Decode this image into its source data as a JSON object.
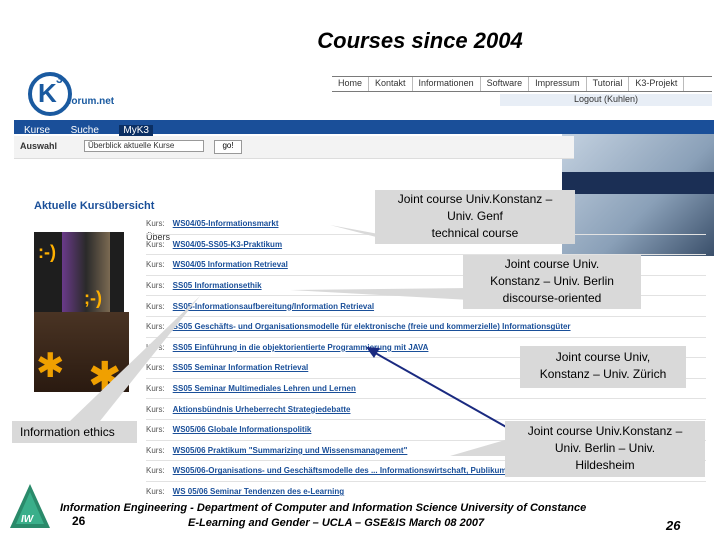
{
  "slide": {
    "title": "Courses since 2004",
    "footer_line1": "Information Engineering - Department of Computer and Information Science University of Constance",
    "footer_line2": "E-Learning and Gender – UCLA – GSE&IS March 08 2007",
    "page_left": "26",
    "page_right": "26"
  },
  "site": {
    "logo_letter": "K",
    "logo_sup": "3",
    "logo_text": "forum.net",
    "top_nav": [
      "Home",
      "Kontakt",
      "Informationen",
      "Software",
      "Impressum",
      "Tutorial",
      "K3-Projekt"
    ],
    "logout": "Logout (Kuhlen)",
    "nav_tabs": [
      "Kurse",
      "Suche",
      "MyK3"
    ],
    "auswahl_label": "Auswahl",
    "select_value": "Überblick aktuelle Kurse",
    "go_label": "go!",
    "content_title": "Aktuelle Kursübersicht",
    "ubers_label": "Übers",
    "course_prefix": "Kurs:",
    "courses": [
      "WS04/05-Informationsmarkt",
      "WS04/05-SS05-K3-Praktikum",
      "WS04/05 Information Retrieval",
      "SS05 Informationsethik",
      "SS05-Informationsaufbereitung/Information Retrieval",
      "SS05 Geschäfts- und Organisationsmodelle für elektronische (freie und kommerzielle) Informationsgüter",
      "SS05 Einführung in die objektorientierte Programmierung mit JAVA",
      "SS05 Seminar Information Retrieval",
      "SS05 Seminar Multimediales Lehren und Lernen",
      "Aktionsbündnis Urheberrecht Strategiedebatte",
      "WS05/06 Globale Informationspolitik",
      "WS05/06 Praktikum \"Summarizing und Wissensmanagement\"",
      "WS05/06-Organisations- und Geschäftsmodelle des ... Informationswirtschaft, Publikumsmärkte)",
      "WS 05/06 Seminar Tendenzen des e-Learning"
    ],
    "smileys": [
      ":-)",
      ";-)"
    ]
  },
  "callouts": {
    "c1": [
      "Joint course Univ.Konstanz –",
      "Univ. Genf",
      "technical course"
    ],
    "c2": [
      "Joint course Univ.",
      "Konstanz – Univ. Berlin",
      "discourse-oriented"
    ],
    "c3": [
      "Joint course Univ,",
      "Konstanz – Univ. Zürich"
    ],
    "c4": "Information ethics",
    "c5": [
      "Joint course Univ.Konstanz –",
      "Univ. Berlin – Univ.",
      "Hildesheim"
    ]
  }
}
